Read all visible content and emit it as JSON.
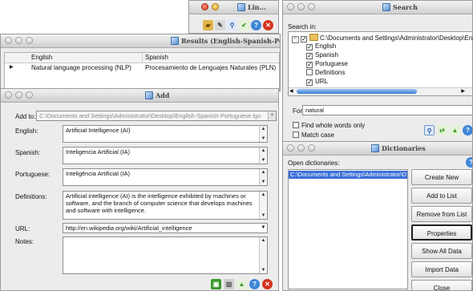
{
  "toolbar_win": {
    "title": "Lin..."
  },
  "results": {
    "title": "Results (English-Spanish-Portu",
    "columns": [
      "English",
      "Spanish"
    ],
    "row": {
      "marker": "▶",
      "english": "Natural language processing (NLP)",
      "spanish": "Procesamiento de Lenguajes Naturales (PLN)"
    }
  },
  "add": {
    "title": "Add",
    "add_to_label": "Add to:",
    "add_to_value": "C:\\Documents and Settings\\Administrator\\Desktop\\English-Spanish-Portuguese.lgo",
    "english_label": "English:",
    "english_value": "Artificial Intelligence (AI)",
    "spanish_label": "Spanish:",
    "spanish_value": "Inteligencia Artificial (IA)",
    "portuguese_label": "Portuguese:",
    "portuguese_value": "Inteligência Artificial (IA)",
    "definitions_label": "Definitions:",
    "definitions_value": "Artificial intelligence (AI) is the intelligence exhibited by machines or software, and the branch of computer science that develops machines and software with intelligence.",
    "url_label": "URL:",
    "url_value": "http://en.wikipedia.org/wiki/Artificial_intelligence",
    "notes_label": "Notes:",
    "notes_value": ""
  },
  "search": {
    "title": "Search",
    "search_in_label": "Search in:",
    "path": "C:\\Documents and Settings\\Administrator\\Desktop\\English-",
    "items": [
      {
        "label": "English",
        "checked": true
      },
      {
        "label": "Spanish",
        "checked": true
      },
      {
        "label": "Portuguese",
        "checked": true
      },
      {
        "label": "Definitions",
        "checked": false
      },
      {
        "label": "URL",
        "checked": true
      }
    ],
    "for_label": "For:",
    "for_value": "natural",
    "whole_words_label": "Find whole words only",
    "match_case_label": "Match case"
  },
  "dictionaries": {
    "title": "Dictionaries",
    "open_label": "Open dictionaries:",
    "list_item": "C:\\Documents and Settings\\Administrator\\D",
    "buttons": [
      "Create New",
      "Add to List",
      "Remove from List",
      "Properties",
      "Show All Data",
      "Import Data",
      "Close"
    ]
  },
  "colors": {
    "selection": "#3a6fd8",
    "accent_red": "#d5321c",
    "accent_green": "#3a9a2a"
  }
}
